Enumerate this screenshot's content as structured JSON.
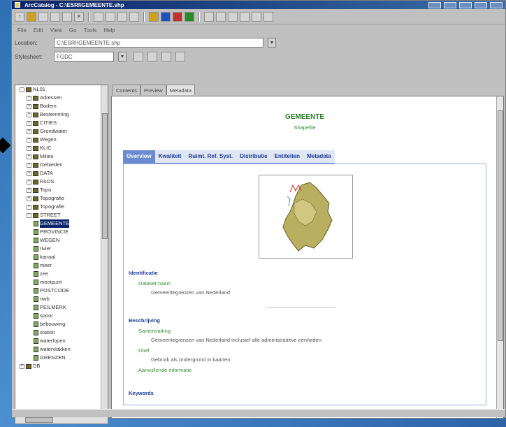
{
  "window": {
    "title": "ArcCatalog - C:\\ESRI\\GEMEENTE.shp"
  },
  "menu": {
    "items": [
      "File",
      "Edit",
      "View",
      "Go",
      "Tools",
      "Help"
    ]
  },
  "location": {
    "label": "Location:",
    "value": "C:\\ESRI\\GEMEENTE.shp"
  },
  "stylesheet": {
    "label": "Stylesheet:",
    "value": "FGDC"
  },
  "view_tabs": [
    "Contents",
    "Preview",
    "Metadata"
  ],
  "tree": [
    {
      "label": "NL01",
      "level": 0,
      "type": "folder",
      "expand": "-"
    },
    {
      "label": "Adressen",
      "level": 1,
      "type": "folder",
      "expand": "+"
    },
    {
      "label": "Bodem",
      "level": 1,
      "type": "folder",
      "expand": "+"
    },
    {
      "label": "Bestemming",
      "level": 1,
      "type": "folder",
      "expand": "+"
    },
    {
      "label": "CITIES",
      "level": 1,
      "type": "folder",
      "expand": "+"
    },
    {
      "label": "Grondwater",
      "level": 1,
      "type": "folder",
      "expand": "+"
    },
    {
      "label": "Wegen",
      "level": 1,
      "type": "folder",
      "expand": "+"
    },
    {
      "label": "KLIC",
      "level": 1,
      "type": "folder",
      "expand": "+"
    },
    {
      "label": "Milieu",
      "level": 1,
      "type": "folder",
      "expand": "+"
    },
    {
      "label": "Gebieden",
      "level": 1,
      "type": "folder",
      "expand": "+"
    },
    {
      "label": "DATA",
      "level": 1,
      "type": "folder",
      "expand": "+"
    },
    {
      "label": "RoOS",
      "level": 1,
      "type": "folder",
      "expand": "+"
    },
    {
      "label": "Topo",
      "level": 1,
      "type": "folder",
      "expand": "+"
    },
    {
      "label": "Topografie",
      "level": 1,
      "type": "folder",
      "expand": "+"
    },
    {
      "label": "Topografie",
      "level": 1,
      "type": "folder",
      "expand": "+"
    },
    {
      "label": "STREET",
      "level": 1,
      "type": "folder",
      "expand": "-"
    },
    {
      "label": "GEMEENTE",
      "level": 2,
      "type": "leaf",
      "selected": true
    },
    {
      "label": "PROVINCIE",
      "level": 2,
      "type": "leaf"
    },
    {
      "label": "WEGEN",
      "level": 2,
      "type": "leaf"
    },
    {
      "label": "rivier",
      "level": 2,
      "type": "leaf"
    },
    {
      "label": "kanaal",
      "level": 2,
      "type": "leaf"
    },
    {
      "label": "meer",
      "level": 2,
      "type": "leaf"
    },
    {
      "label": "zee",
      "level": 2,
      "type": "leaf"
    },
    {
      "label": "meetpunt",
      "level": 2,
      "type": "leaf"
    },
    {
      "label": "POSTCODE",
      "level": 2,
      "type": "leaf"
    },
    {
      "label": "nwb",
      "level": 2,
      "type": "leaf"
    },
    {
      "label": "PEILMERK",
      "level": 2,
      "type": "leaf"
    },
    {
      "label": "spoor",
      "level": 2,
      "type": "leaf"
    },
    {
      "label": "bebouwing",
      "level": 2,
      "type": "leaf"
    },
    {
      "label": "station",
      "level": 2,
      "type": "leaf"
    },
    {
      "label": "waterlopen",
      "level": 2,
      "type": "leaf"
    },
    {
      "label": "watervlakken",
      "level": 2,
      "type": "leaf"
    },
    {
      "label": "GRENZEN",
      "level": 2,
      "type": "leaf"
    },
    {
      "label": "DB",
      "level": 0,
      "type": "folder",
      "expand": "+"
    }
  ],
  "metadata": {
    "title": "GEMEENTE",
    "subtitle": "Shapefile",
    "tabs": [
      "Overview",
      "Kwaliteit",
      "Ruimt. Ref. Syst.",
      "Distributie",
      "Entiteiten",
      "Metadata"
    ],
    "active_tab_index": 0,
    "identification_heading": "Identificatie",
    "id_key": "Dataset naam",
    "id_value": "Gemeentegrenzen van Nederland",
    "description_heading": "Beschrijving",
    "desc_key1": "Samenvatting",
    "desc_value1": "Gemeentegrenzen van Nederland inclusief alle administratieve eenheden",
    "desc_key2": "Doel",
    "desc_value2": "Gebruik als ondergrond in kaarten",
    "desc_key3": "Aanvullende informatie",
    "section_keywords": "Keywords"
  }
}
